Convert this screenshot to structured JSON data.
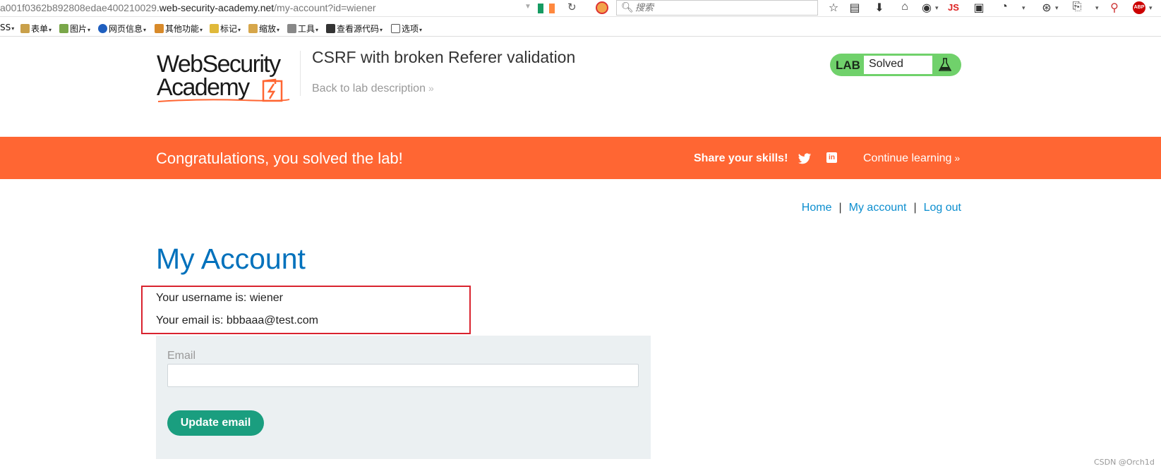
{
  "browser": {
    "url_prefix": "a001f0362b892808edae400210029.",
    "url_host": "web-security-academy.net",
    "url_path": "/my-account?id=wiener",
    "search_placeholder": "搜索",
    "js_badge": "JS",
    "abp_badge": "ABP"
  },
  "menubar": {
    "items": [
      {
        "label": "SS"
      },
      {
        "label": "表单"
      },
      {
        "label": "图片"
      },
      {
        "label": "网页信息"
      },
      {
        "label": "其他功能"
      },
      {
        "label": "标记"
      },
      {
        "label": "缩放"
      },
      {
        "label": "工具"
      },
      {
        "label": "查看源代码"
      },
      {
        "label": "选项"
      }
    ]
  },
  "header": {
    "logo_line1": "WebSecurity",
    "logo_line2": "Academy",
    "lab_title": "CSRF with broken Referer validation",
    "back_link": "Back to lab description",
    "status_label": "LAB",
    "status_value": "Solved"
  },
  "banner": {
    "message": "Congratulations, you solved the lab!",
    "share": "Share your skills!",
    "linkedin": "in",
    "continue": "Continue learning"
  },
  "nav": {
    "home": "Home",
    "account": "My account",
    "logout": "Log out",
    "separator": "|"
  },
  "account": {
    "title": "My Account",
    "username_line": "Your username is: wiener",
    "email_line": "Your email is: bbbaaa@test.com",
    "email_label": "Email",
    "email_value": "",
    "update_button": "Update email"
  },
  "colors": {
    "accent_orange": "#ff6633",
    "heading_blue": "#0071bc",
    "link_blue": "#0c8ecf",
    "solved_green": "#70d16b",
    "button_teal": "#1a9e7f",
    "highlight_red": "#d9232f"
  },
  "watermark": "CSDN @Orch1d"
}
